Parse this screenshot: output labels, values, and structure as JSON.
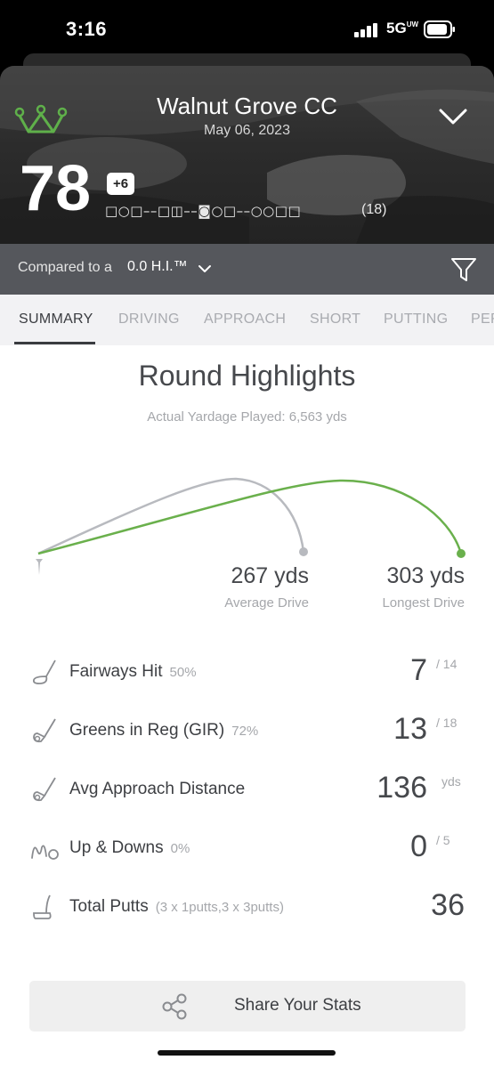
{
  "status_bar": {
    "time": "3:16",
    "network": "5G",
    "network_sub": "UW"
  },
  "header": {
    "course_name": "Walnut Grove CC",
    "date": "May 06, 2023",
    "score": "78",
    "to_par": "+6",
    "hole_markers": "□○□––□◫––◙○□––○○□□",
    "holes_count": "(18)",
    "accent_color": "#5fb04a"
  },
  "compare": {
    "label": "Compared to a",
    "value": "0.0 H.I.™"
  },
  "tabs": [
    "SUMMARY",
    "DRIVING",
    "APPROACH",
    "SHORT",
    "PUTTING",
    "PER"
  ],
  "active_tab": "SUMMARY",
  "highlights": {
    "title": "Round Highlights",
    "subtitle": "Actual Yardage Played: 6,563 yds",
    "average_drive": {
      "value": "267 yds",
      "label": "Average Drive",
      "color": "#b8babf"
    },
    "longest_drive": {
      "value": "303 yds",
      "label": "Longest Drive",
      "color": "#6ab04c"
    }
  },
  "stats": [
    {
      "icon": "driver-icon",
      "label": "Fairways Hit",
      "pct": "50%",
      "value": "7",
      "of": "/ 14"
    },
    {
      "icon": "iron-icon",
      "label": "Greens in Reg (GIR)",
      "pct": "72%",
      "value": "13",
      "of": "/ 18"
    },
    {
      "icon": "iron-icon",
      "label": "Avg Approach Distance",
      "pct": "",
      "value": "136",
      "of": "yds"
    },
    {
      "icon": "chip-icon",
      "label": "Up & Downs",
      "pct": "0%",
      "value": "0",
      "of": "/ 5"
    },
    {
      "icon": "putter-icon",
      "label": "Total Putts",
      "pct": "(3 x 1putts,3 x 3putts)",
      "value": "36",
      "of": ""
    }
  ],
  "share": {
    "label": "Share Your Stats"
  }
}
